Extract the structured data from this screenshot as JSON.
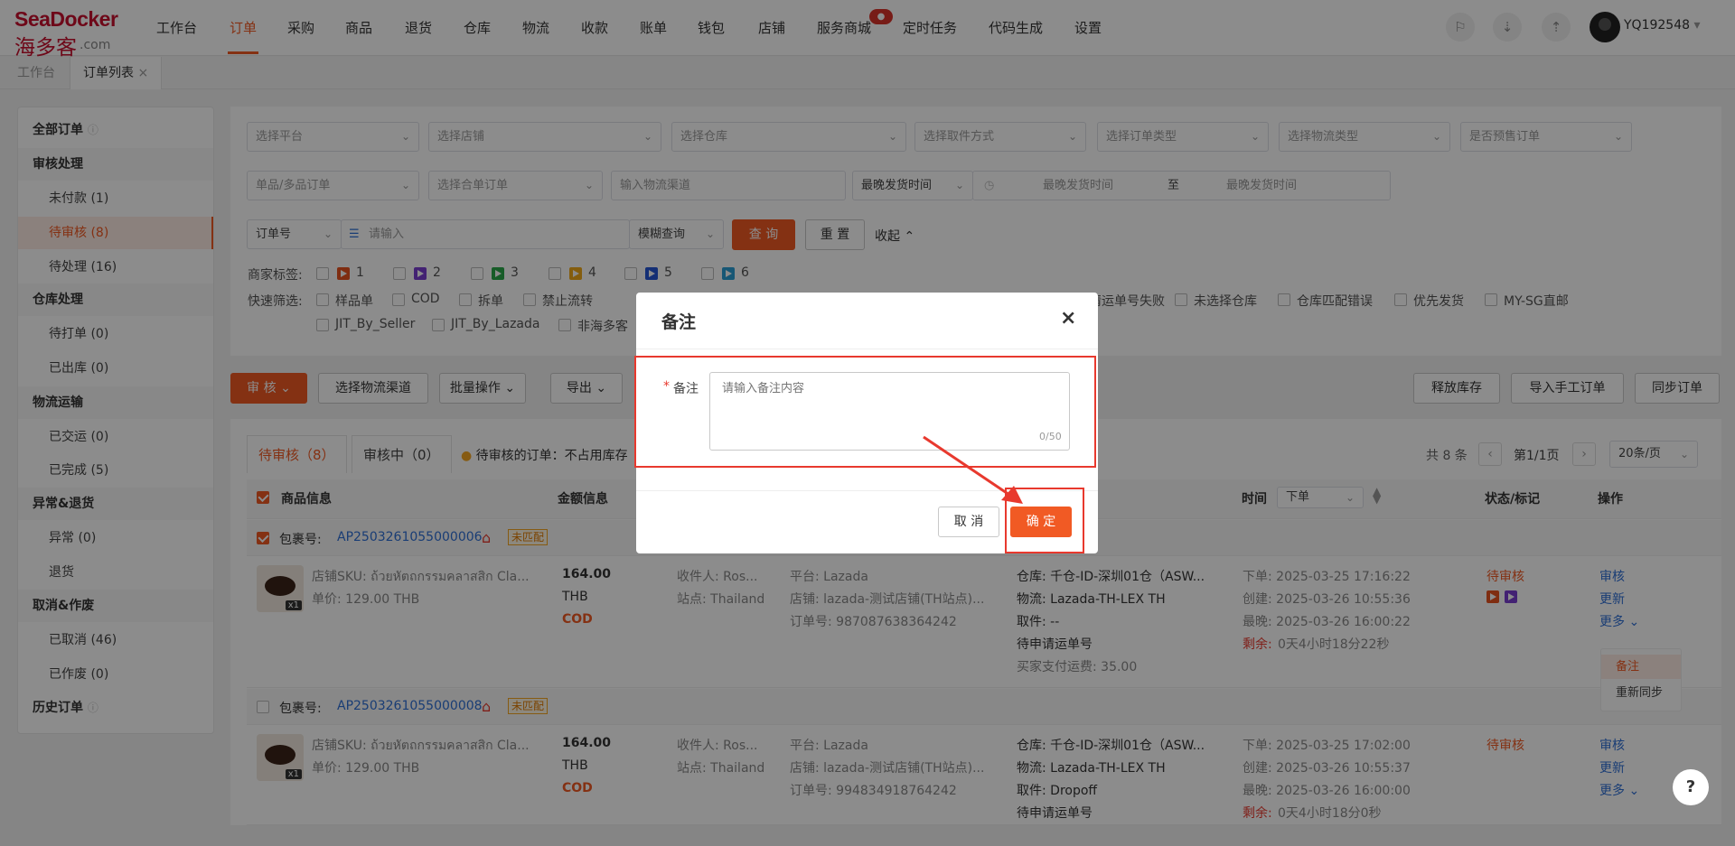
{
  "brand": {
    "line1": "SeaDocker",
    "line2": "海多客",
    "line3": ".com"
  },
  "nav": [
    "工作台",
    "订单",
    "采购",
    "商品",
    "退货",
    "仓库",
    "物流",
    "收款",
    "账单",
    "钱包",
    "店铺",
    "服务商城",
    "定时任务",
    "代码生成",
    "设置"
  ],
  "nav_badge": "●",
  "user": "YQ192548",
  "user_caret": "▾",
  "page_tabs": [
    "工作台",
    "订单列表"
  ],
  "page_tab_close": "×",
  "sidebar": {
    "all": "全部订单",
    "info": "ⓘ",
    "review": "审核处理",
    "unpaid": "未付款 (1)",
    "pending_review": "待审核 (8)",
    "pending_process": "待处理 (16)",
    "warehouse": "仓库处理",
    "to_print": "待打单 (0)",
    "shipped": "已出库 (0)",
    "logistics": "物流运输",
    "delivered": "已交运 (0)",
    "completed": "已完成 (5)",
    "exception": "异常&退货",
    "abnormal": "异常 (0)",
    "returns": "退货",
    "cancel": "取消&作废",
    "cancelled": "已取消 (46)",
    "voided": "已作废 (0)",
    "history": "历史订单"
  },
  "filters": {
    "platform": "选择平台",
    "shop": "选择店铺",
    "warehouse": "选择仓库",
    "pickup": "选择取件方式",
    "order_type": "选择订单类型",
    "logistics_type": "选择物流类型",
    "presale": "是否预售订单",
    "single_multi": "单品/多品订单",
    "merge": "选择合单订单",
    "channel": "输入物流渠道",
    "latest_ship": "最晚发货时间",
    "date_start": "最晚发货时间",
    "date_to": "至",
    "date_end": "最晚发货时间",
    "order_no": "订单号",
    "input": "请输入",
    "fuzzy": "模糊查询",
    "query": "查 询",
    "reset": "重 置",
    "collapse": "收起"
  },
  "merchant_tags_label": "商家标签:",
  "merchant_tags": [
    "1",
    "2",
    "3",
    "4",
    "5",
    "6"
  ],
  "tag_colors": [
    "#e8531f",
    "#7a3fd1",
    "#2aa84a",
    "#f0a91b",
    "#2557d6",
    "#2b9ed6"
  ],
  "quick_label": "快速筛选:",
  "quick_row1": [
    "样品单",
    "COD",
    "拆单",
    "禁止流转"
  ],
  "quick_row1_right": [
    "请运单号失败",
    "未选择仓库",
    "仓库匹配错误",
    "优先发货",
    "MY-SG直邮"
  ],
  "quick_row2": [
    "JIT_By_Seller",
    "JIT_By_Lazada",
    "非海多客"
  ],
  "actions": {
    "audit": "审 核",
    "channel": "选择物流渠道",
    "batch": "批量操作",
    "export": "导出",
    "release": "释放库存",
    "import": "导入手工订单",
    "sync": "同步订单"
  },
  "content_tabs": {
    "pending": "待审核（8）",
    "in_review": "审核中（0）",
    "tip": "待审核的订单：不占用库存"
  },
  "pager": {
    "total": "共 8 条",
    "page": "第1/1页",
    "size": "20条/页",
    "prev": "‹",
    "next": "›"
  },
  "columns": {
    "product": "商品信息",
    "amount": "金额信息",
    "time": "时间",
    "time_sel": "下单",
    "status": "状态/标记",
    "op": "操作"
  },
  "orders": [
    {
      "pkg_label": "包裹号:",
      "pkg": "AP2503261055000006",
      "unmatched": "未匹配",
      "sku": "店铺SKU: ถ้วยหัตถกรรมคลาสสิก Cla...",
      "price": "单价: 129.00 THB",
      "qty": "x1",
      "amount": "164.00",
      "currency": "THB",
      "cod": "COD",
      "receiver": "收件人: Ros...",
      "site": "站点: Thailand",
      "platform": "平台: Lazada",
      "shop": "店铺: lazada-测试店铺(TH站点)...",
      "order_no": "订单号: 987087638364242",
      "wh": "仓库: 千仓-ID-深圳01仓（ASW...",
      "logi": "物流: Lazada-TH-LEX TH",
      "pick": "取件: --",
      "await": "待申请运单号",
      "fee": "买家支付运费: 35.00",
      "t1": "下单: 2025-03-25 17:16:22",
      "t2": "创建: 2025-03-26 10:55:36",
      "t3": "最晚: 2025-03-26 16:00:22",
      "remain_l": "剩余:",
      "remain": "0天4小时18分22秒",
      "status": "待审核",
      "op1": "审核",
      "op2": "更新",
      "op3": "更多"
    },
    {
      "pkg_label": "包裹号:",
      "pkg": "AP2503261055000008",
      "unmatched": "未匹配",
      "sku": "店铺SKU: ถ้วยหัตถกรรมคลาสสิก Cla...",
      "price": "单价: 129.00 THB",
      "qty": "x1",
      "amount": "164.00",
      "currency": "THB",
      "cod": "COD",
      "receiver": "收件人: Ros...",
      "site": "站点: Thailand",
      "platform": "平台: Lazada",
      "shop": "店铺: lazada-测试店铺(TH站点)...",
      "order_no": "订单号: 994834918764242",
      "wh": "仓库: 千仓-ID-深圳01仓（ASW...",
      "logi": "物流: Lazada-TH-LEX TH",
      "pick": "取件: Dropoff",
      "await": "待申请运单号",
      "t1": "下单: 2025-03-25 17:02:00",
      "t2": "创建: 2025-03-26 10:55:37",
      "t3": "最晚: 2025-03-26 16:00:00",
      "remain_l": "剩余:",
      "remain": "0天4小时18分0秒",
      "status": "待审核",
      "op1": "审核",
      "op2": "更新",
      "op3": "更多"
    }
  ],
  "more_menu": [
    "备注",
    "重新同步"
  ],
  "modal": {
    "title": "备注",
    "close": "×",
    "required": "*",
    "label": "备注",
    "placeholder": "请输入备注内容",
    "counter": "0/50",
    "cancel": "取 消",
    "ok": "确 定"
  },
  "help": "?"
}
